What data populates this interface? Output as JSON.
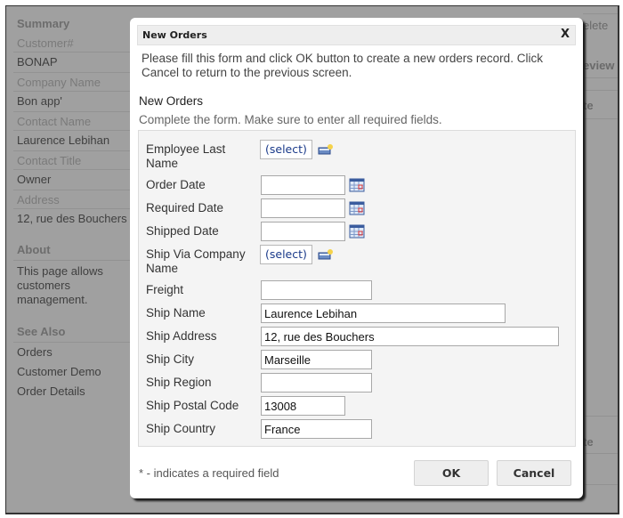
{
  "background": {
    "sidebar": {
      "summary_heading": "Summary",
      "fields": [
        {
          "label": "Customer#",
          "value": "BONAP"
        },
        {
          "label": "Company Name",
          "value": "Bon app'"
        },
        {
          "label": "Contact Name",
          "value": "Laurence Lebihan"
        },
        {
          "label": "Contact Title",
          "value": "Owner"
        },
        {
          "label": "Address",
          "value": "12, rue des Bouchers"
        }
      ],
      "about_heading": "About",
      "about_text": "This page allows customers management.",
      "see_also_heading": "See Also",
      "links": [
        "Orders",
        "Customer Demo",
        "Order Details"
      ]
    },
    "right_fragments": [
      "elete",
      "eview",
      "te",
      "te"
    ]
  },
  "dialog": {
    "title": "New Orders",
    "close_label": "X",
    "description": "Please fill this form and click OK button to create a new orders record. Click Cancel to return to the previous screen.",
    "form_title": "New Orders",
    "form_subtitle": "Complete the form. Make sure to enter all required fields.",
    "fields": {
      "employee_last_name": {
        "label": "Employee Last Name",
        "value": "(select)"
      },
      "order_date": {
        "label": "Order Date",
        "value": ""
      },
      "required_date": {
        "label": "Required Date",
        "value": ""
      },
      "shipped_date": {
        "label": "Shipped Date",
        "value": ""
      },
      "ship_via": {
        "label": "Ship Via Company Name",
        "value": "(select)"
      },
      "freight": {
        "label": "Freight",
        "value": ""
      },
      "ship_name": {
        "label": "Ship Name",
        "value": "Laurence Lebihan"
      },
      "ship_address": {
        "label": "Ship Address",
        "value": "12, rue des Bouchers"
      },
      "ship_city": {
        "label": "Ship City",
        "value": "Marseille"
      },
      "ship_region": {
        "label": "Ship Region",
        "value": ""
      },
      "ship_postal_code": {
        "label": "Ship Postal Code",
        "value": "13008"
      },
      "ship_country": {
        "label": "Ship Country",
        "value": "France"
      }
    },
    "required_note": "* - indicates a required field",
    "ok_label": "OK",
    "cancel_label": "Cancel"
  }
}
